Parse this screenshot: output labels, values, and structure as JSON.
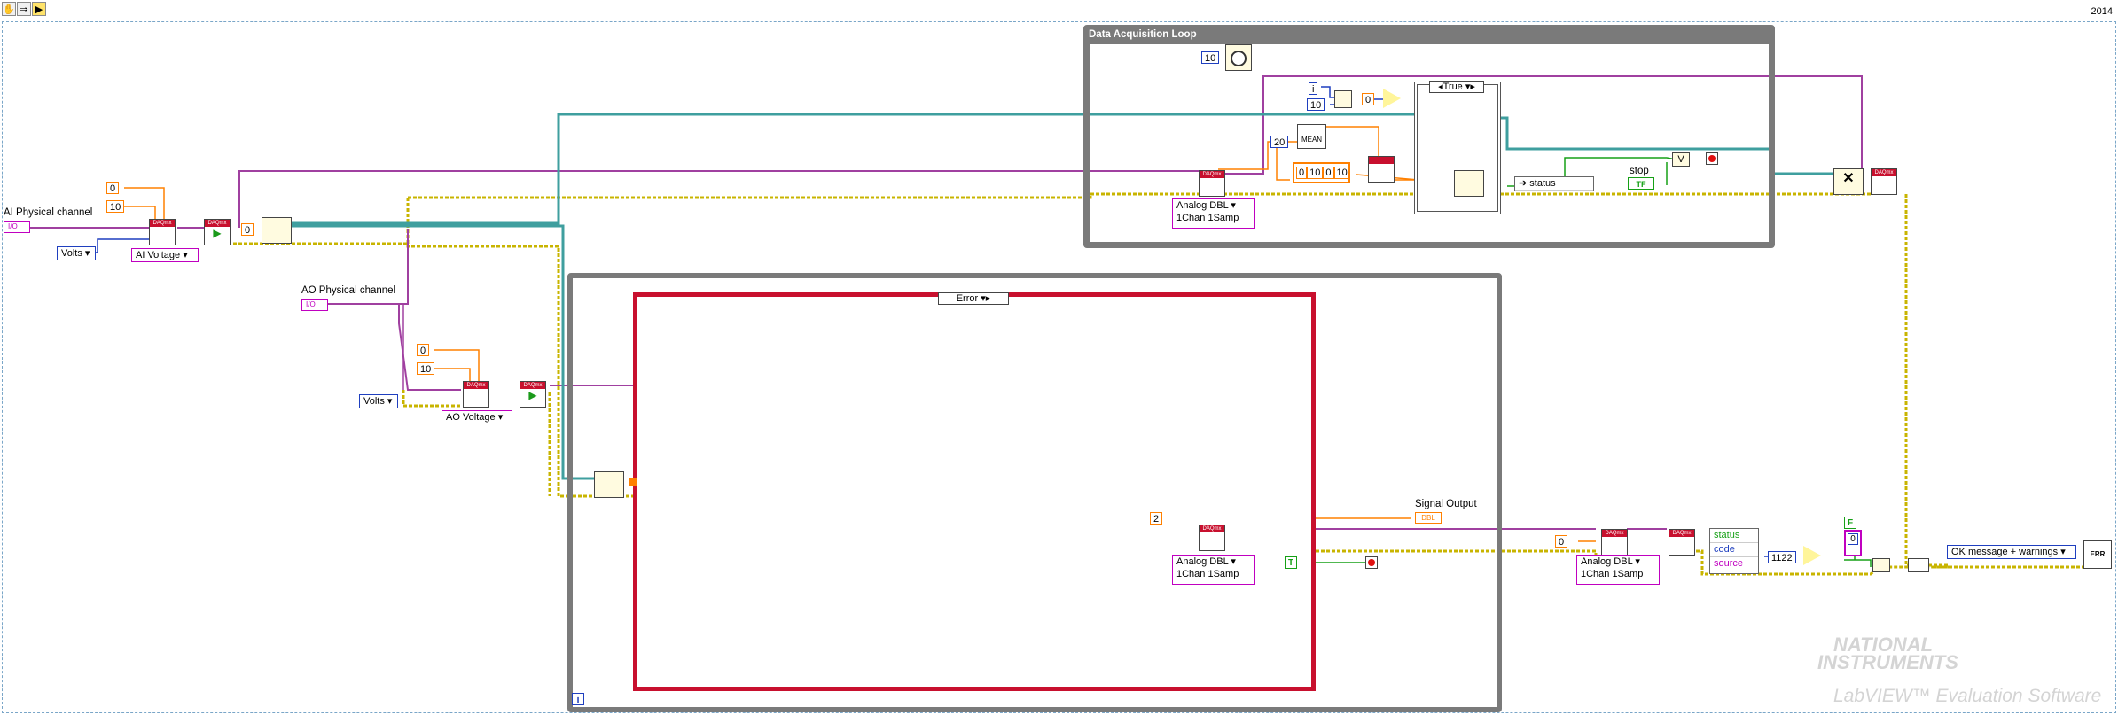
{
  "toolbar": {
    "version": "2014"
  },
  "icons": [
    "hand-icon",
    "arrow-right-icon",
    "run-icon",
    "timer-icon",
    "equals-icon",
    "x-icon",
    "error-icon"
  ],
  "labels": {
    "ai_physical_channel": "AI Physical channel",
    "ao_physical_channel": "AO Physical channel",
    "data_acq_loop": "Data Acquisition Loop",
    "signal_output": "Signal Output",
    "stop": "stop",
    "mean": "MEAN",
    "status": "status",
    "daqmx": "DAQmx"
  },
  "constants": {
    "ai_min": "0",
    "ai_max": "10",
    "ai_units": "Volts",
    "ai_type": "AI Voltage",
    "zero1": "0",
    "ao_min": "0",
    "ao_max": "10",
    "ao_units": "Volts",
    "ao_type": "AO Voltage",
    "wait": "10",
    "iter": "i",
    "modulo": "10",
    "eq_zero": "0",
    "num20": "20",
    "array": [
      "0",
      "10",
      "0",
      "10"
    ],
    "case_true": "True",
    "case_error": "Error",
    "write_val": "2",
    "write_final": "0",
    "err_code": "1122",
    "bool_f": "F",
    "bool_t": "T",
    "bool_zero": "0",
    "tf": "TF",
    "ai_read": "Analog DBL",
    "ai_read2": "1Chan 1Samp",
    "ao_write": "Analog DBL",
    "ao_write2": "1Chan 1Samp",
    "final_write": "Analog DBL",
    "final_write2": "1Chan 1Samp",
    "ok_msg": "OK message + warnings",
    "i_term": "i"
  },
  "bundle": [
    "status",
    "code",
    "source"
  ],
  "case_status": "status",
  "colors": {
    "error_wire": "#c8b400",
    "task_wire": "#a040a0",
    "dbl_wire": "#ff8000",
    "int_wire": "#1f3fbf",
    "bool_wire": "#16a016",
    "teal_wire": "#3f9f9f",
    "loop_frame": "#7a7a7a",
    "case_frame": "#c8102e"
  },
  "logo": {
    "line1": "NATIONAL",
    "line2": "INSTRUMENTS",
    "line3": "LabVIEW™ Evaluation Software"
  }
}
